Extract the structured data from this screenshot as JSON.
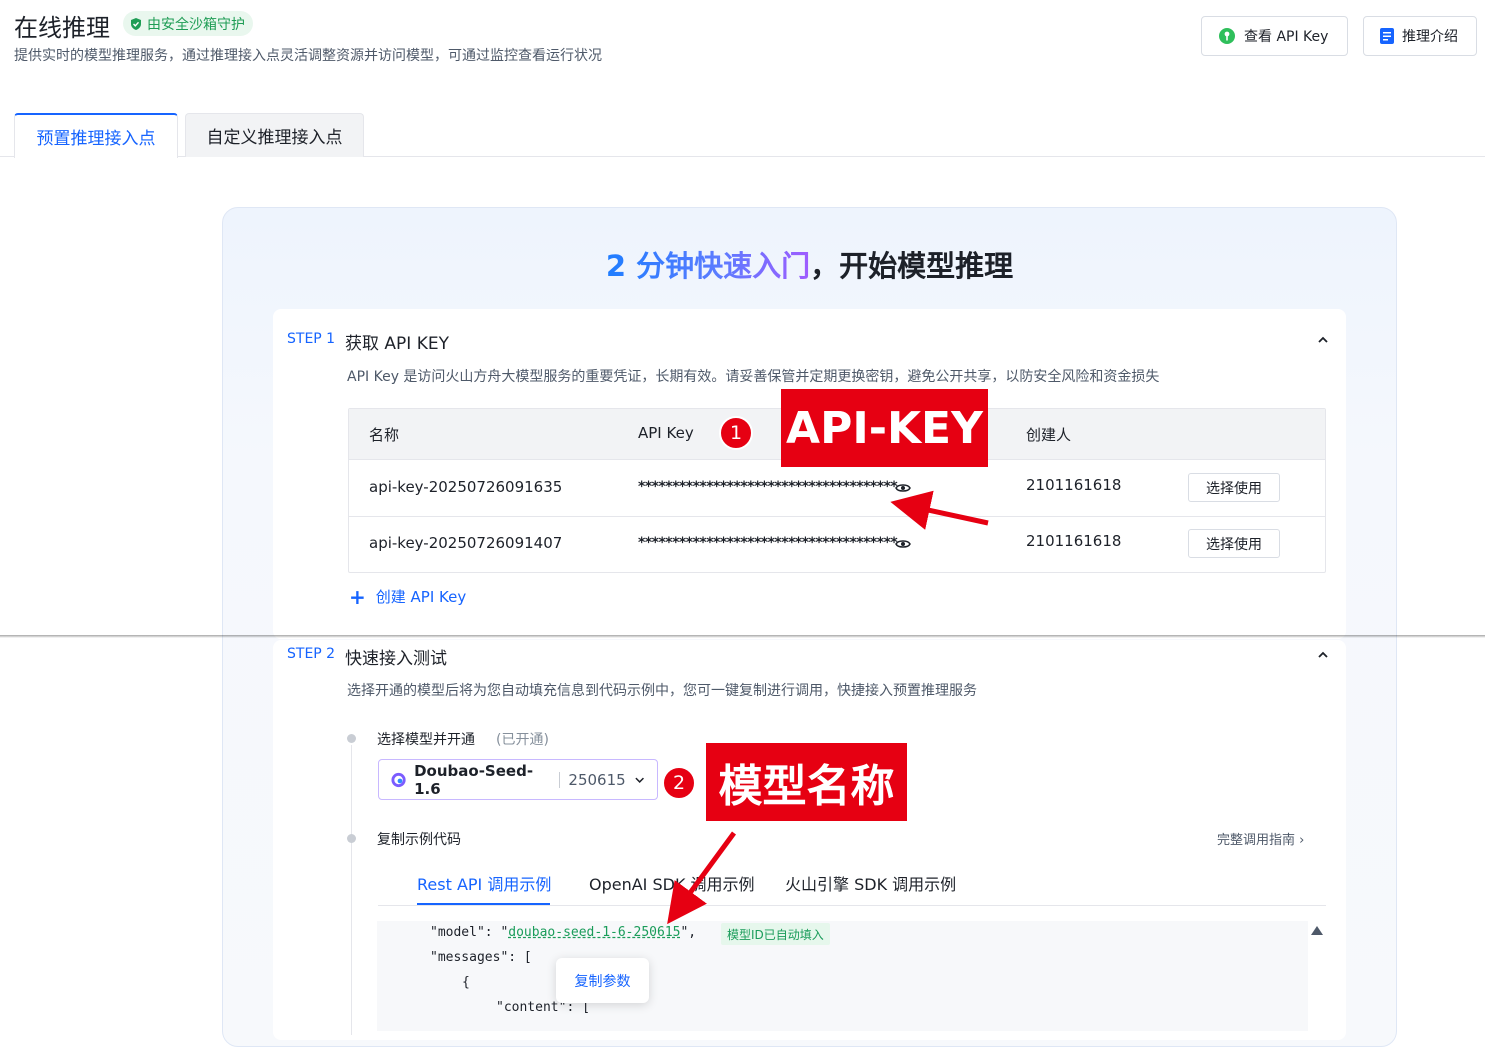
{
  "header": {
    "title": "在线推理",
    "badge": "由安全沙箱守护",
    "description": "提供实时的模型推理服务，通过推理接入点灵活调整资源并访问模型，可通过监控查看运行状况",
    "view_api_key_label": "查看 API Key",
    "intro_label": "推理介绍"
  },
  "tabs": [
    {
      "label": "预置推理接入点",
      "active": true
    },
    {
      "label": "自定义推理接入点",
      "active": false
    }
  ],
  "hero": {
    "highlight": "2 分钟快速入门",
    "rest": "，开始模型推理"
  },
  "step1": {
    "step": "STEP 1",
    "title": "获取 API KEY",
    "desc": "API Key 是访问火山方舟大模型服务的重要凭证，长期有效。请妥善保管并定期更换密钥，避免公开共享，以防安全风险和资金损失",
    "columns": [
      "名称",
      "API Key",
      "创建人"
    ],
    "rows": [
      {
        "name": "api-key-20250726091635",
        "key": "**************************************",
        "creator": "2101161618",
        "action": "选择使用"
      },
      {
        "name": "api-key-20250726091407",
        "key": "**************************************",
        "creator": "2101161618",
        "action": "选择使用"
      }
    ],
    "create_label": "创建 API Key"
  },
  "step2": {
    "step": "STEP 2",
    "title": "快速接入测试",
    "desc": "选择开通的模型后将为您自动填充信息到代码示例中，您可一键复制进行调用，快捷接入预置推理服务",
    "select_label": "选择模型并开通",
    "select_status": "(已开通)",
    "model_name": "Doubao-Seed-1.6",
    "model_version": "250615",
    "copy_code_label": "复制示例代码",
    "full_guide": "完整调用指南 ›",
    "code_tabs": [
      {
        "label": "Rest API 调用示例",
        "active": true
      },
      {
        "label": "OpenAI SDK 调用示例",
        "active": false
      },
      {
        "label": "火山引擎 SDK 调用示例",
        "active": false
      }
    ],
    "code": {
      "model_key": "\"model\": \"",
      "model_value": "doubao-seed-1-6-250615",
      "model_end": "\",",
      "line2": "\"messages\": [",
      "line3": "{",
      "line4": "\"content\": ["
    },
    "autofill_tag": "模型ID已自动填入",
    "copy_params": "复制参数"
  },
  "annotations": {
    "badge1": "1",
    "callout1": "API-KEY",
    "badge2": "2",
    "callout2": "模型名称",
    "color": "#e60012"
  },
  "colors": {
    "primary": "#1664ff",
    "success": "#1a9c5a"
  }
}
